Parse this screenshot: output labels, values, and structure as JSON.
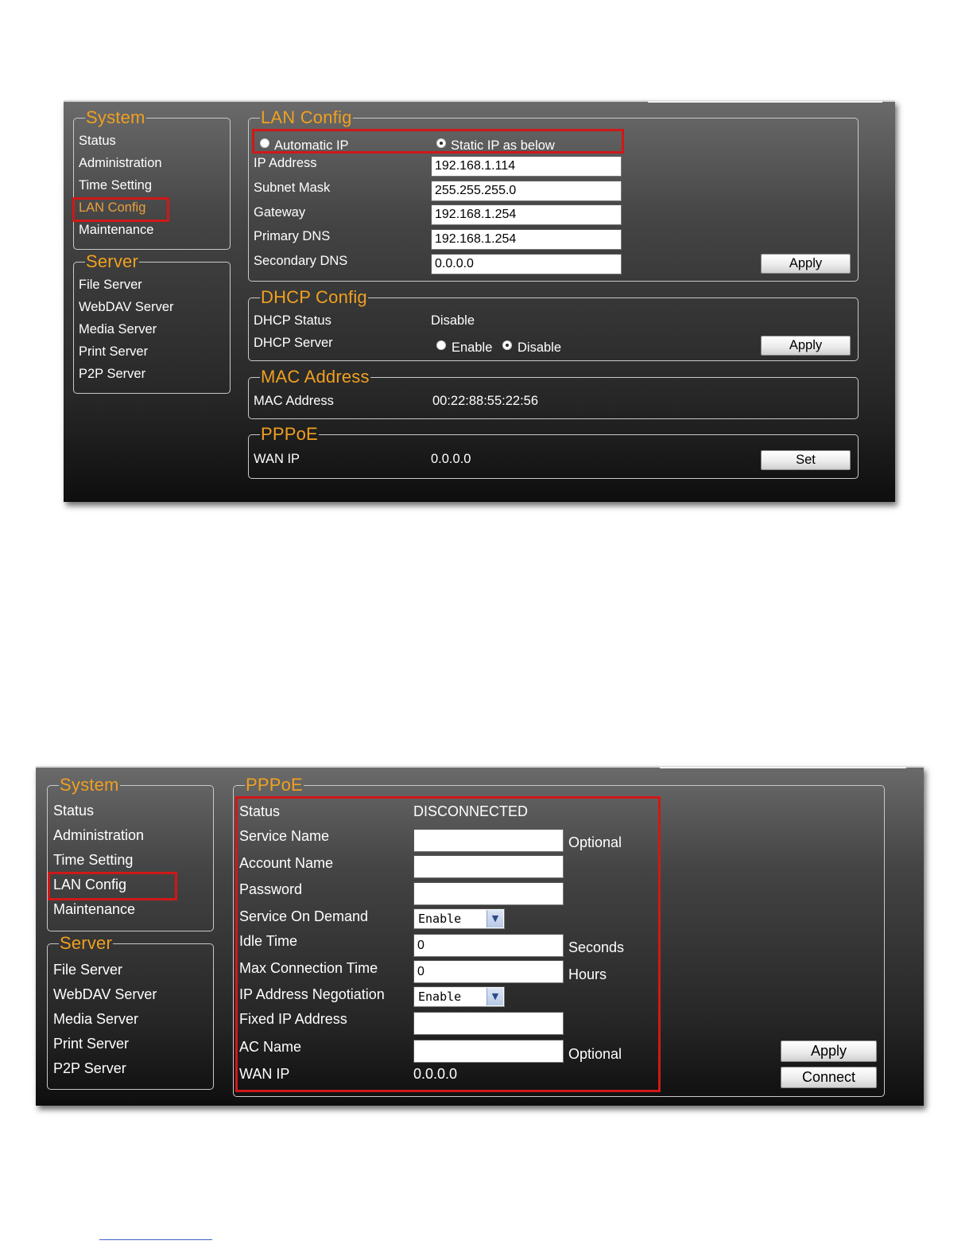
{
  "screen1": {
    "sidebar": {
      "system_title": "System",
      "system_items": [
        "Status",
        "Administration",
        "Time Setting",
        "LAN Config",
        "Maintenance"
      ],
      "server_title": "Server",
      "server_items": [
        "File Server",
        "WebDAV Server",
        "Media Server",
        "Print Server",
        "P2P Server"
      ]
    },
    "lan": {
      "title": "LAN Config",
      "auto_ip_label": "Automatic IP",
      "static_ip_label": "Static IP as below",
      "selected_mode": "Static IP as below",
      "fields": [
        {
          "label": "IP Address",
          "value": "192.168.1.114"
        },
        {
          "label": "Subnet Mask",
          "value": "255.255.255.0"
        },
        {
          "label": "Gateway",
          "value": "192.168.1.254"
        },
        {
          "label": "Primary DNS",
          "value": "192.168.1.254"
        },
        {
          "label": "Secondary DNS",
          "value": "0.0.0.0"
        }
      ],
      "apply_label": "Apply"
    },
    "dhcp": {
      "title": "DHCP Config",
      "status_label": "DHCP Status",
      "status_value": "Disable",
      "server_label": "DHCP Server",
      "enable_label": "Enable",
      "disable_label": "Disable",
      "selected": "Disable",
      "apply_label": "Apply"
    },
    "mac": {
      "title": "MAC Address",
      "label": "MAC Address",
      "value": "00:22:88:55:22:56"
    },
    "pppoe": {
      "title": "PPPoE",
      "wan_label": "WAN IP",
      "wan_value": "0.0.0.0",
      "set_label": "Set"
    }
  },
  "screen2": {
    "sidebar": {
      "system_title": "System",
      "system_items": [
        "Status",
        "Administration",
        "Time Setting",
        "LAN Config",
        "Maintenance"
      ],
      "server_title": "Server",
      "server_items": [
        "File Server",
        "WebDAV Server",
        "Media Server",
        "Print Server",
        "P2P Server"
      ]
    },
    "pppoe": {
      "title": "PPPoE",
      "status_label": "Status",
      "status_value": "DISCONNECTED",
      "service_name_label": "Service Name",
      "service_name_value": "",
      "service_name_hint": "Optional",
      "account_name_label": "Account Name",
      "account_name_value": "",
      "password_label": "Password",
      "password_value": "",
      "service_on_demand_label": "Service On Demand",
      "service_on_demand_value": "Enable",
      "idle_time_label": "Idle Time",
      "idle_time_value": "0",
      "idle_time_unit": "Seconds",
      "max_conn_label": "Max Connection Time",
      "max_conn_value": "0",
      "max_conn_unit": "Hours",
      "ip_neg_label": "IP Address Negotiation",
      "ip_neg_value": "Enable",
      "fixed_ip_label": "Fixed IP Address",
      "fixed_ip_value": "",
      "ac_name_label": "AC Name",
      "ac_name_value": "",
      "ac_name_hint": "Optional",
      "wan_label": "WAN IP",
      "wan_value": "0.0.0.0",
      "apply_label": "Apply",
      "connect_label": "Connect"
    }
  },
  "colors": {
    "accent": "#f0a020",
    "highlight": "#d01818",
    "link_underline": "#3b5fc6"
  }
}
